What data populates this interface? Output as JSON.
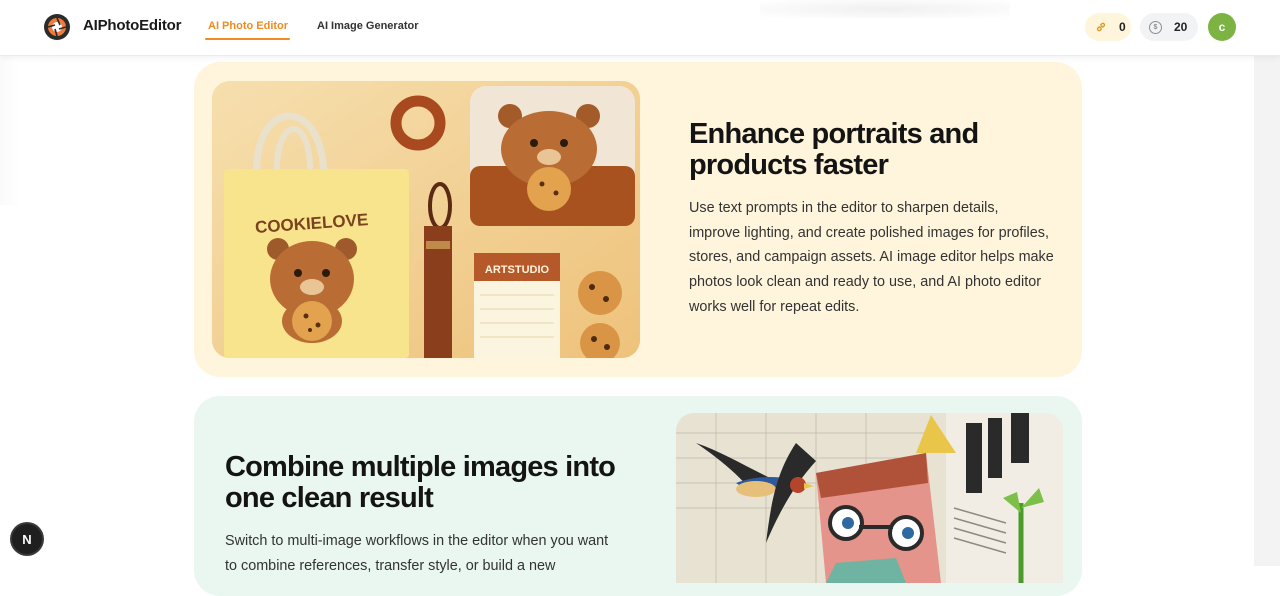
{
  "brand": {
    "name": "AIPhotoEditor"
  },
  "nav": [
    {
      "label": "AI Photo Editor",
      "active": true
    },
    {
      "label": "AI Image Generator",
      "active": false
    }
  ],
  "header": {
    "invite_count": "0",
    "credits": "20",
    "avatar_letter": "c"
  },
  "sections": [
    {
      "title_line1": "Enhance portraits and",
      "title_line2": "products faster",
      "body": [
        "Use text prompts in the editor to sharpen details,",
        "improve lighting, and create polished images for profiles,",
        "stores, and campaign assets. AI image editor helps make",
        "photos look clean and ready to use, and AI photo editor",
        "works well for repeat edits."
      ],
      "image_text": {
        "bag": "COOKIELOVE",
        "notepad": "ARTSTUDIO"
      }
    },
    {
      "title_line1": "Combine multiple images into",
      "title_line2": "one clean result",
      "body": [
        "Switch to multi-image workflows in the editor when you want",
        "to combine references, transfer style, or build a new"
      ]
    }
  ],
  "fab": {
    "label": "N"
  },
  "colors": {
    "accent": "#f08c1e",
    "card1_bg": "#fff5dc",
    "card2_bg": "#e9f7f0",
    "avatar": "#7cb342"
  }
}
